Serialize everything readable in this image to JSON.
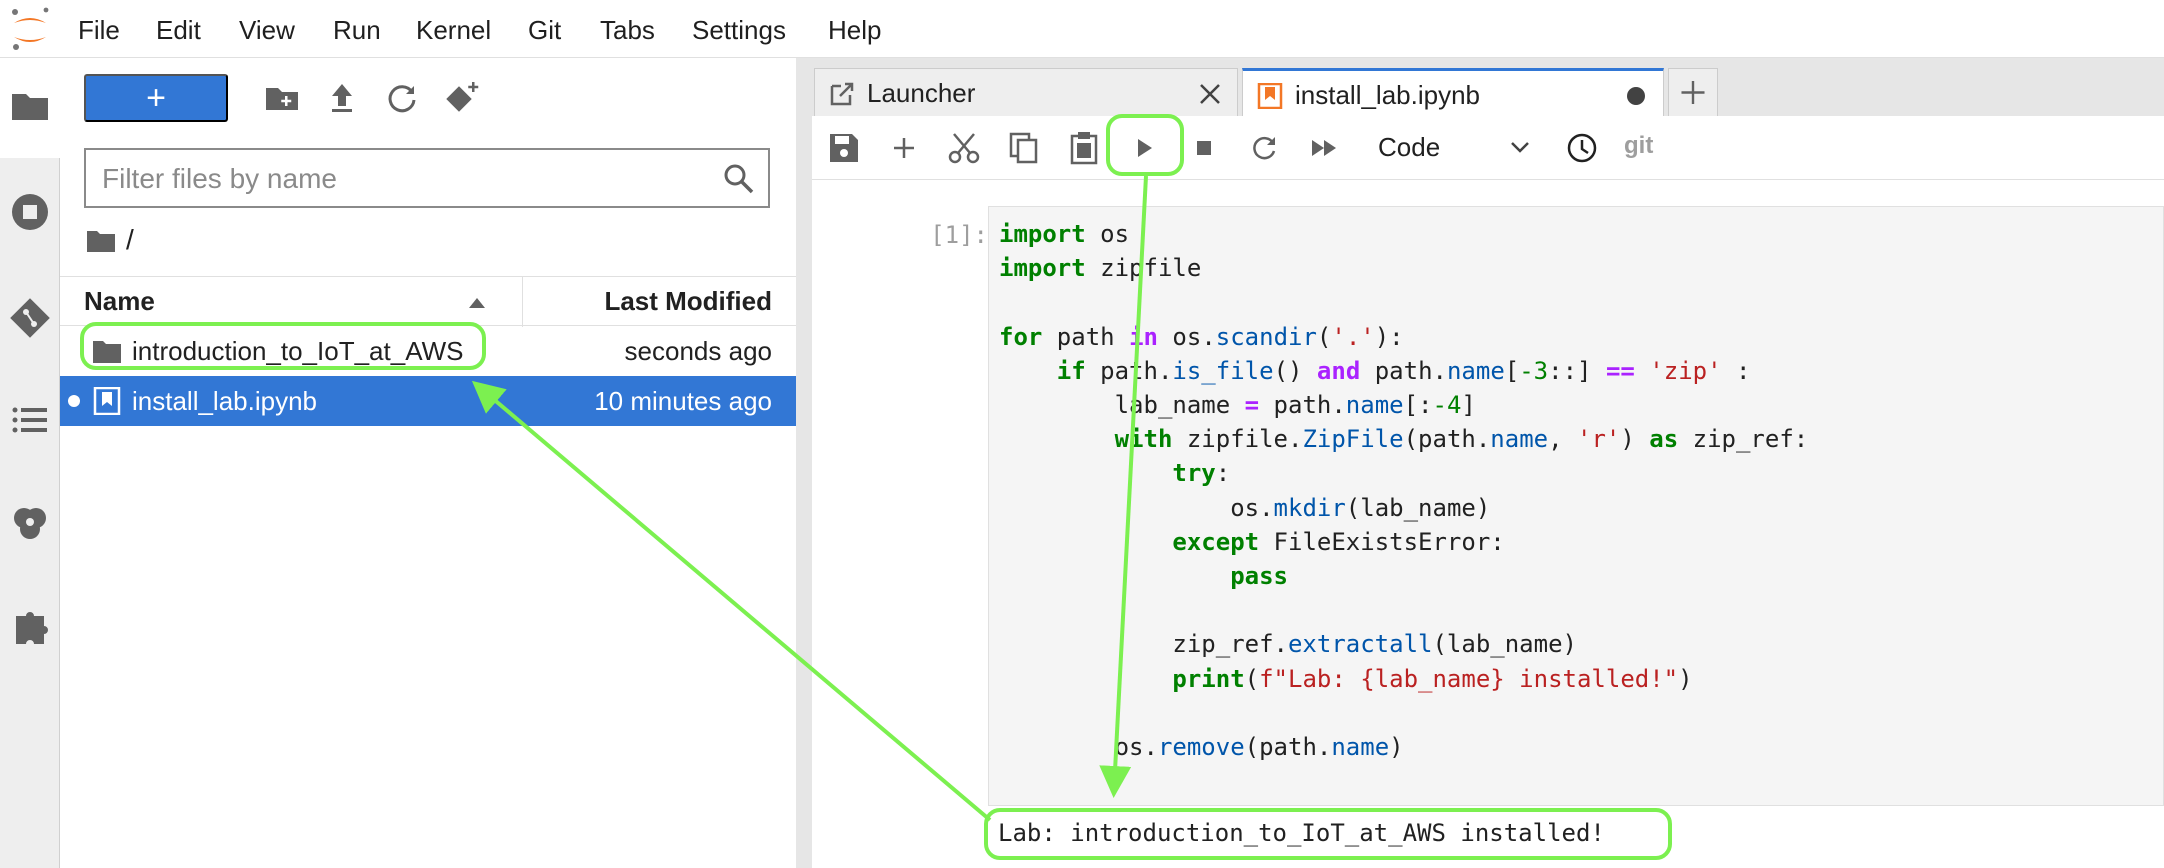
{
  "menu": {
    "items": [
      "File",
      "Edit",
      "View",
      "Run",
      "Kernel",
      "Git",
      "Tabs",
      "Settings",
      "Help"
    ]
  },
  "activity_bar": {
    "icons": [
      "folder-icon",
      "running-icon",
      "git-icon",
      "toc-icon",
      "property-inspector-icon",
      "extension-icon"
    ]
  },
  "file_browser": {
    "new_button_label": "+",
    "filter_placeholder": "Filter files by name",
    "breadcrumb": "/",
    "columns": {
      "name": "Name",
      "modified": "Last Modified"
    },
    "files": [
      {
        "name": "introduction_to_IoT_at_AWS",
        "type": "folder",
        "modified": "seconds ago",
        "selected": false
      },
      {
        "name": "install_lab.ipynb",
        "type": "notebook",
        "modified": "10 minutes ago",
        "selected": true
      }
    ]
  },
  "tabs": [
    {
      "label": "Launcher",
      "active": false
    },
    {
      "label": "install_lab.ipynb",
      "active": true
    }
  ],
  "notebook_toolbar": {
    "cell_type": "Code",
    "git_label": "git"
  },
  "cell": {
    "prompt": "[1]:",
    "output": "Lab: introduction_to_IoT_at_AWS installed!"
  },
  "colors": {
    "accent": "#3277d5",
    "annotation": "#7cf050"
  }
}
